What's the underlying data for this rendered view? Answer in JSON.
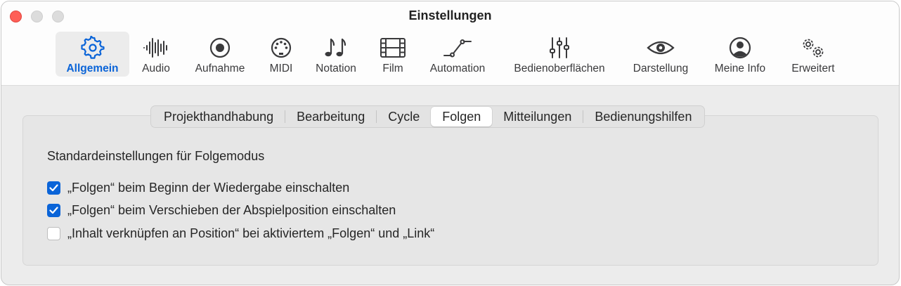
{
  "window": {
    "title": "Einstellungen"
  },
  "toolbar": {
    "items": [
      {
        "label": "Allgemein",
        "icon": "gear-icon",
        "active": true
      },
      {
        "label": "Audio",
        "icon": "waveform-icon"
      },
      {
        "label": "Aufnahme",
        "icon": "record-icon"
      },
      {
        "label": "MIDI",
        "icon": "midi-port-icon"
      },
      {
        "label": "Notation",
        "icon": "music-notes-icon"
      },
      {
        "label": "Film",
        "icon": "film-icon"
      },
      {
        "label": "Automation",
        "icon": "automation-curve-icon"
      },
      {
        "label": "Bedienoberflächen",
        "icon": "sliders-icon"
      },
      {
        "label": "Darstellung",
        "icon": "eye-icon"
      },
      {
        "label": "Meine Info",
        "icon": "person-icon"
      },
      {
        "label": "Erweitert",
        "icon": "gears-icon"
      }
    ],
    "accent_color": "#0a64d8"
  },
  "tabs": [
    {
      "label": "Projekthandhabung"
    },
    {
      "label": "Bearbeitung"
    },
    {
      "label": "Cycle"
    },
    {
      "label": "Folgen",
      "selected": true
    },
    {
      "label": "Mitteilungen"
    },
    {
      "label": "Bedienungshilfen"
    }
  ],
  "section": {
    "heading": "Standardeinstellungen für Folgemodus",
    "options": [
      {
        "label": "„Folgen“ beim Beginn der Wiedergabe einschalten",
        "checked": true
      },
      {
        "label": "„Folgen“ beim Verschieben der Abspielposition einschalten",
        "checked": true
      },
      {
        "label": "„Inhalt verknüpfen an Position“ bei aktiviertem „Folgen“ und „Link“",
        "checked": false
      }
    ]
  }
}
